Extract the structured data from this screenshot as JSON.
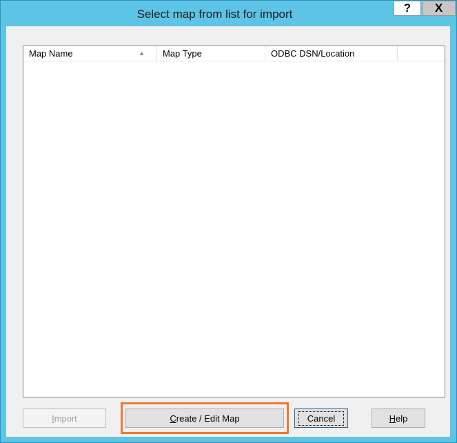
{
  "dialog": {
    "title": "Select map from list for import",
    "help_button": "?",
    "close_button": "X"
  },
  "listview": {
    "columns": [
      "Map Name",
      "Map Type",
      "ODBC DSN/Location"
    ],
    "sort_indicator": "▲",
    "rows": []
  },
  "buttons": {
    "import": {
      "prefix": "",
      "accel": "I",
      "rest": "mport",
      "enabled": false
    },
    "create_edit": {
      "prefix": "",
      "accel": "C",
      "rest": "reate / Edit Map"
    },
    "cancel": {
      "label": "Cancel"
    },
    "help": {
      "prefix": "",
      "accel": "H",
      "rest": "elp"
    }
  },
  "colors": {
    "titlebar": "#5dc4e6",
    "highlight": "#f07a2a"
  }
}
